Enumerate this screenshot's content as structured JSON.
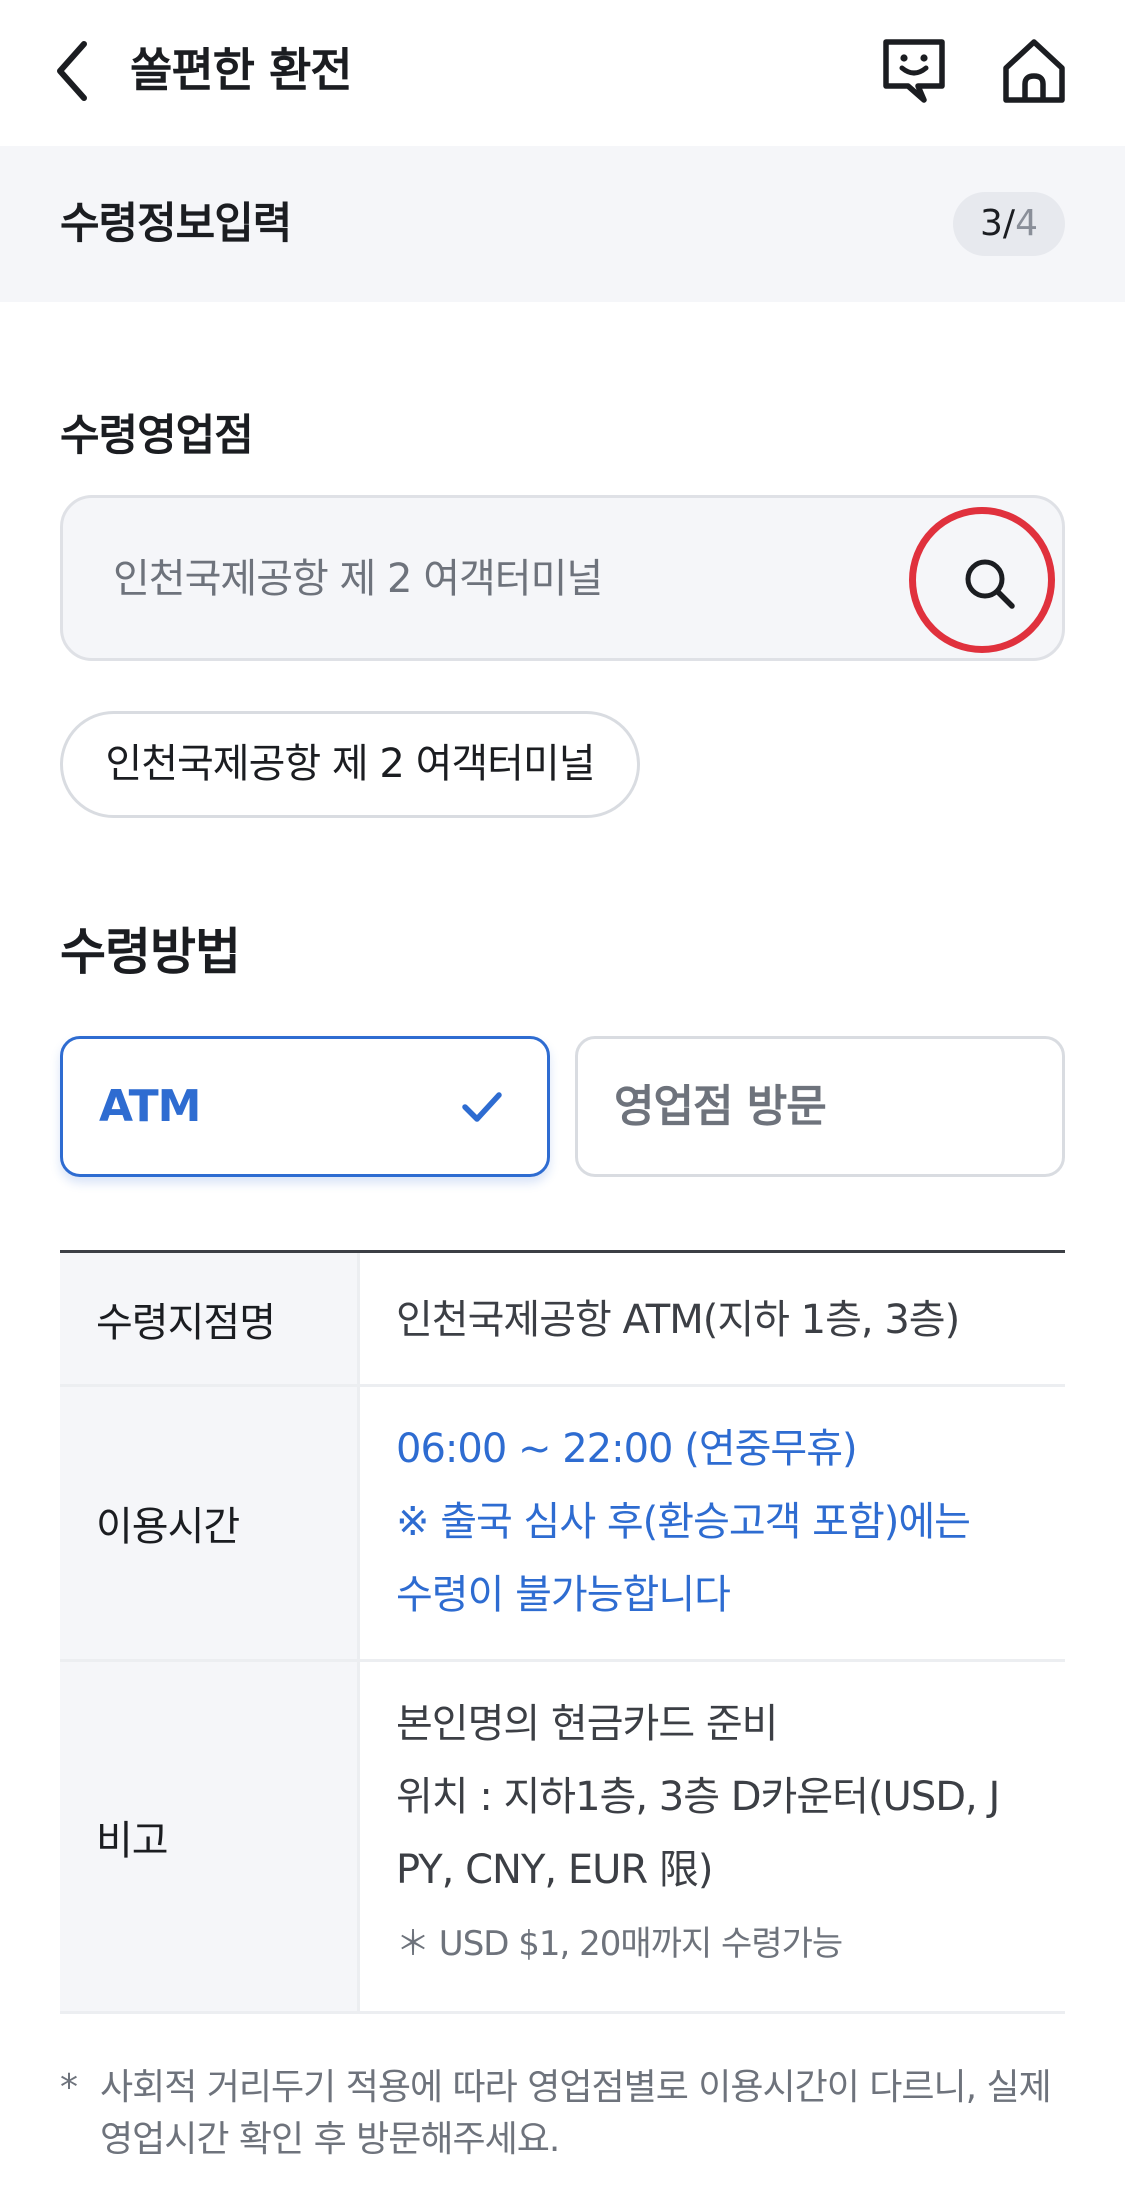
{
  "header": {
    "title": "쏠편한 환전",
    "back_icon": "chevron-left-icon",
    "chat_icon": "chatbot-icon",
    "home_icon": "home-icon"
  },
  "step": {
    "title": "수령정보입력",
    "current": "3",
    "separator": "/",
    "total": "4"
  },
  "branch": {
    "label": "수령영업점",
    "search_placeholder": "인천국제공항 제 2 여객터미널",
    "search_icon": "search-icon",
    "highlight_color": "#e0313d",
    "chip_label": "인천국제공항 제 2 여객터미널"
  },
  "method": {
    "label": "수령방법",
    "options": [
      {
        "label": "ATM",
        "selected": true
      },
      {
        "label": "영업점 방문",
        "selected": false
      }
    ],
    "accent_color": "#2e6cd1"
  },
  "info": {
    "rows": [
      {
        "head": "수령지점명",
        "lines": [
          "인천국제공항 ATM(지하 1층, 3층)"
        ]
      },
      {
        "head": "이용시간",
        "lines": [
          "06:00 ~ 22:00 (연중무휴)",
          "※ 출국 심사 후(환승고객 포함)에는",
          "수령이 불가능합니다"
        ]
      },
      {
        "head": "비고",
        "lines": [
          "본인명의 현금카드 준비",
          "위치 : 지하1층, 3층 D카운터(USD, J",
          "PY, CNY, EUR 限)"
        ],
        "note": "＊ USD $1, 20매까지 수령가능"
      }
    ]
  },
  "footnote": {
    "star": "*",
    "text": "사회적 거리두기 적용에 따라 영업점별로 이용시간이 다르니, 실제 영업시간 확인 후 방문해주세요."
  }
}
